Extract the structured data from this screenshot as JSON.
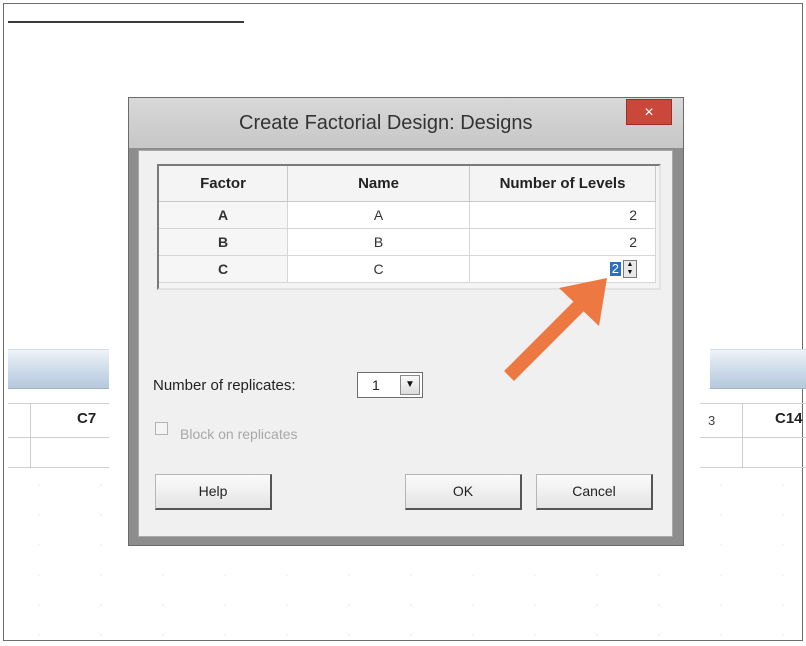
{
  "dialog": {
    "title": "Create Factorial Design: Designs",
    "close_label": "×"
  },
  "grid": {
    "headers": [
      "Factor",
      "Name",
      "Number of Levels"
    ],
    "rows": [
      {
        "factor": "A",
        "name": "A",
        "levels": "2"
      },
      {
        "factor": "B",
        "name": "B",
        "levels": "2"
      },
      {
        "factor": "C",
        "name": "C",
        "levels": "2"
      }
    ]
  },
  "replicates": {
    "label": "Number of replicates:",
    "value": "1"
  },
  "block": {
    "label": "Block on replicates",
    "checked": false,
    "enabled": false
  },
  "buttons": {
    "help": "Help",
    "ok": "OK",
    "cancel": "Cancel"
  },
  "worksheet": {
    "col_left": "C7",
    "col_right": "C14",
    "fragment": "3"
  },
  "colors": {
    "annotation_arrow": "#ee7842",
    "close_button": "#c9483b",
    "selection": "#2a70c0"
  }
}
